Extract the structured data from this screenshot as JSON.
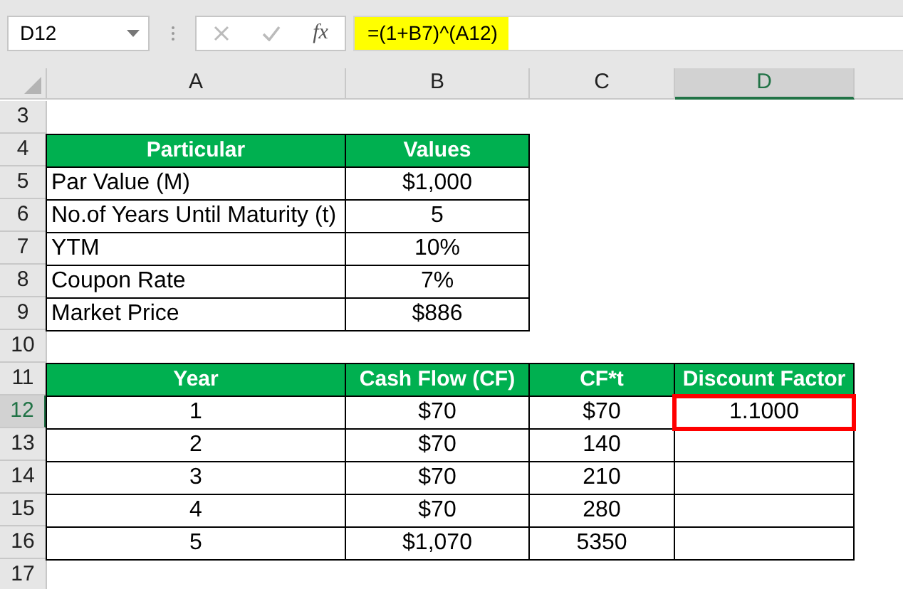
{
  "name_box": {
    "value": "D12"
  },
  "formula_bar": {
    "function_label": "fx",
    "formula": "=(1+B7)^(A12)"
  },
  "columns": [
    {
      "label": "A",
      "selected": false
    },
    {
      "label": "B",
      "selected": false
    },
    {
      "label": "C",
      "selected": false
    },
    {
      "label": "D",
      "selected": true
    }
  ],
  "rows": [
    {
      "number": "3",
      "selected": false,
      "cells": []
    },
    {
      "number": "4",
      "selected": false,
      "cells": [
        {
          "kind": "header",
          "text": "Particular",
          "selected": false
        },
        {
          "kind": "header",
          "text": "Values",
          "selected": false
        }
      ]
    },
    {
      "number": "5",
      "selected": false,
      "cells": [
        {
          "kind": "label",
          "text": "Par Value (M)",
          "selected": false
        },
        {
          "kind": "value",
          "text": "$1,000",
          "selected": false
        }
      ]
    },
    {
      "number": "6",
      "selected": false,
      "cells": [
        {
          "kind": "label",
          "text": "No.of Years Until Maturity (t)",
          "selected": false
        },
        {
          "kind": "value",
          "text": "5",
          "selected": false
        }
      ]
    },
    {
      "number": "7",
      "selected": false,
      "cells": [
        {
          "kind": "label",
          "text": "YTM",
          "selected": false
        },
        {
          "kind": "value",
          "text": "10%",
          "selected": false
        }
      ]
    },
    {
      "number": "8",
      "selected": false,
      "cells": [
        {
          "kind": "label",
          "text": "Coupon Rate",
          "selected": false
        },
        {
          "kind": "value",
          "text": "7%",
          "selected": false
        }
      ]
    },
    {
      "number": "9",
      "selected": false,
      "cells": [
        {
          "kind": "label",
          "text": "Market Price",
          "selected": false
        },
        {
          "kind": "value",
          "text": "$886",
          "selected": false
        }
      ]
    },
    {
      "number": "10",
      "selected": false,
      "cells": []
    },
    {
      "number": "11",
      "selected": false,
      "cells": [
        {
          "kind": "header",
          "text": "Year",
          "selected": false
        },
        {
          "kind": "header",
          "text": "Cash Flow (CF)",
          "selected": false
        },
        {
          "kind": "header",
          "text": "CF*t",
          "selected": false
        },
        {
          "kind": "header",
          "text": "Discount Factor",
          "selected": false
        }
      ]
    },
    {
      "number": "12",
      "selected": true,
      "cells": [
        {
          "kind": "value",
          "text": "1",
          "selected": false
        },
        {
          "kind": "value",
          "text": "$70",
          "selected": false
        },
        {
          "kind": "value",
          "text": "$70",
          "selected": false
        },
        {
          "kind": "value",
          "text": "1.1000",
          "selected": true
        }
      ]
    },
    {
      "number": "13",
      "selected": false,
      "cells": [
        {
          "kind": "value",
          "text": "2",
          "selected": false
        },
        {
          "kind": "value",
          "text": "$70",
          "selected": false
        },
        {
          "kind": "value",
          "text": "140",
          "selected": false
        },
        {
          "kind": "blank",
          "selected": false
        }
      ]
    },
    {
      "number": "14",
      "selected": false,
      "cells": [
        {
          "kind": "value",
          "text": "3",
          "selected": false
        },
        {
          "kind": "value",
          "text": "$70",
          "selected": false
        },
        {
          "kind": "value",
          "text": "210",
          "selected": false
        },
        {
          "kind": "blank",
          "selected": false
        }
      ]
    },
    {
      "number": "15",
      "selected": false,
      "cells": [
        {
          "kind": "value",
          "text": "4",
          "selected": false
        },
        {
          "kind": "value",
          "text": "$70",
          "selected": false
        },
        {
          "kind": "value",
          "text": "280",
          "selected": false
        },
        {
          "kind": "blank",
          "selected": false
        }
      ]
    },
    {
      "number": "16",
      "selected": false,
      "cells": [
        {
          "kind": "value",
          "text": "5",
          "selected": false
        },
        {
          "kind": "value",
          "text": "$1,070",
          "selected": false
        },
        {
          "kind": "value",
          "text": "5350",
          "selected": false
        },
        {
          "kind": "blank",
          "selected": false
        }
      ]
    },
    {
      "number": "17",
      "selected": false,
      "cells": []
    }
  ]
}
